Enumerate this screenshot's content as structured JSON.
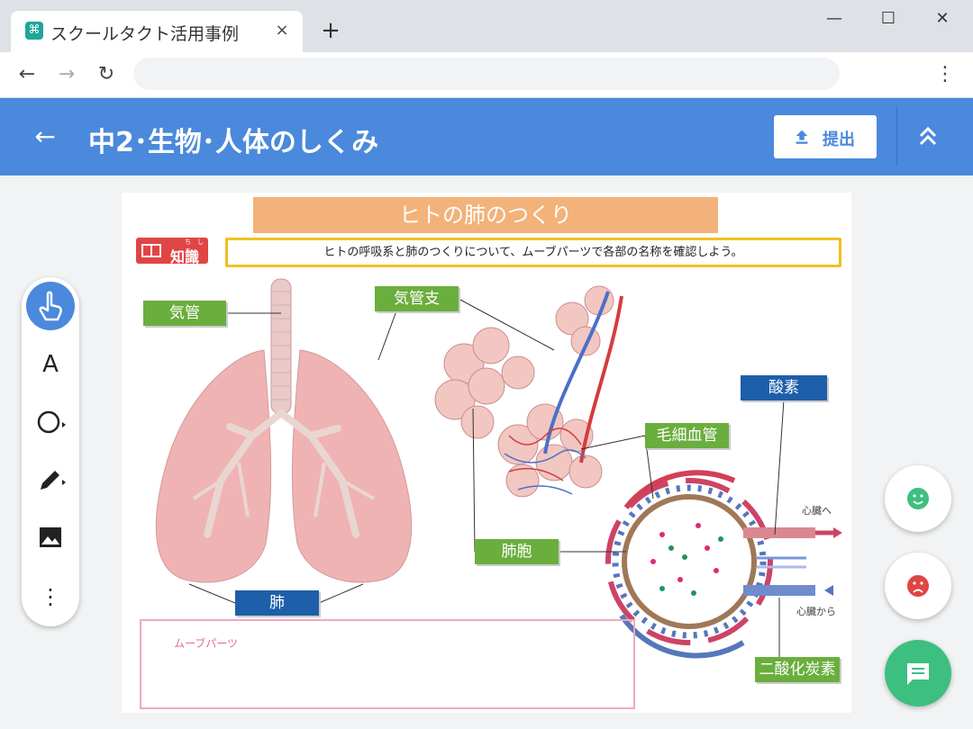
{
  "browser": {
    "tab_title": "スクールタクト活用事例",
    "tab_close": "×",
    "new_tab": "+",
    "minimize": "—",
    "maximize": "☐",
    "close": "✕",
    "back": "←",
    "forward": "→",
    "reload": "↻",
    "menu": "⋮",
    "address": ""
  },
  "app": {
    "title": "中2･生物･人体のしくみ",
    "submit_label": "提出",
    "back_icon": "arrow-back-icon",
    "collapse_icon": "double-chevron-up-icon",
    "header_color": "#4a89dc"
  },
  "worksheet": {
    "title": "ヒトの肺のつくり",
    "badge_ruby": "ち　しき",
    "badge_label": "知識",
    "instruction": "ヒトの呼吸系と肺のつくりについて、ムーブパーツで各部の名称を確認しよう。",
    "labels": {
      "trachea": "気管",
      "bronchus": "気管支",
      "capillary": "毛細血管",
      "alveolus": "肺胞",
      "oxygen": "酸素",
      "lung": "肺",
      "co2": "二酸化炭素"
    },
    "to_heart": "心臓へ",
    "from_heart": "心臓から",
    "move_parts": "ムーブパーツ"
  },
  "tools": {
    "hand_icon": "pointer-hand-icon",
    "text_tool": "A",
    "shape_icon": "circle-shape-icon",
    "pen_icon": "pencil-icon",
    "image_icon": "image-icon",
    "more": "⋮"
  },
  "feedback": {
    "good_icon": "smile-face-icon",
    "bad_icon": "frown-face-icon",
    "chat_icon": "chat-icon",
    "good_color": "#3dbf7f",
    "bad_color": "#e04545"
  }
}
